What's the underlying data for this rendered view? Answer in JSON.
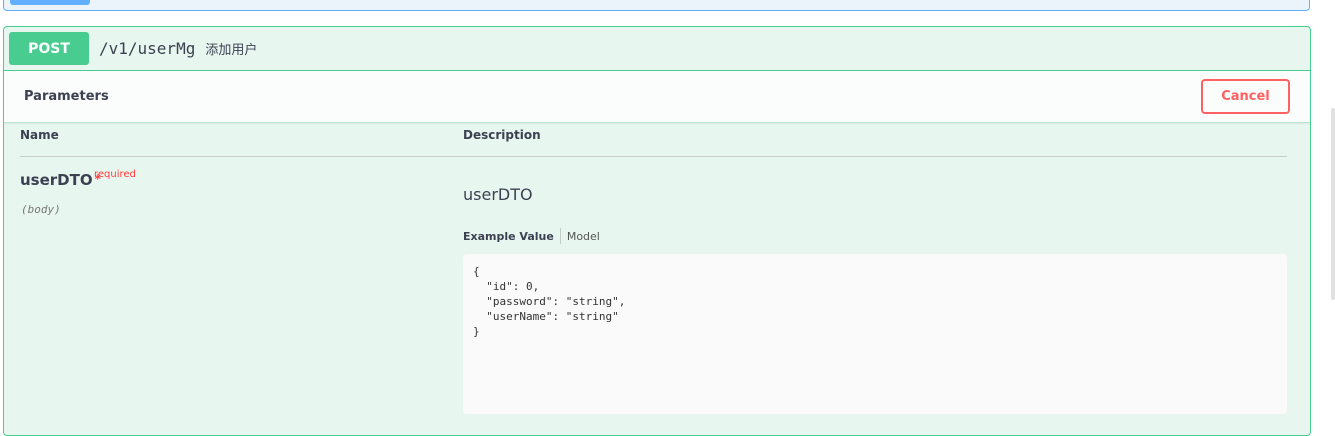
{
  "operation": {
    "method": "POST",
    "path": "/v1/userMg",
    "summary": "添加用户"
  },
  "parameters": {
    "title": "Parameters",
    "cancel_label": "Cancel",
    "columns": {
      "name": "Name",
      "description": "Description"
    },
    "param": {
      "name": "userDTO",
      "required_star": "*",
      "required_label": "required",
      "location": "(body)",
      "description": "userDTO"
    },
    "tabs": {
      "example": "Example Value",
      "model": "Model"
    },
    "example_json": "{\n  \"id\": 0,\n  \"password\": \"string\",\n  \"userName\": \"string\"\n}"
  },
  "colors": {
    "post": "#49cc90",
    "post_bg": "#e8f6f0",
    "get": "#61affe",
    "cancel": "#ff6060"
  }
}
